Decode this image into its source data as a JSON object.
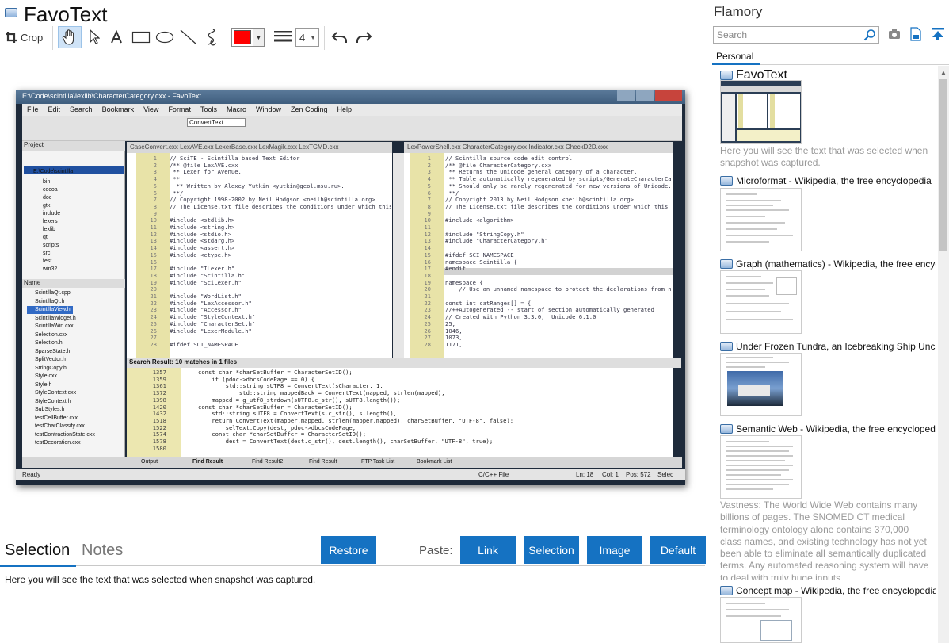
{
  "app": {
    "title": "FavoText"
  },
  "toolbar": {
    "crop_label": "Crop",
    "color": "#ff0000",
    "line_width": "4"
  },
  "snapshot": {
    "window_title": "E:\\Code\\scintilla\\lexlib\\CharacterCategory.cxx - FavoText",
    "menu": [
      "File",
      "Edit",
      "Search",
      "Bookmark",
      "View",
      "Format",
      "Tools",
      "Macro",
      "Window",
      "Zen Coding",
      "Help"
    ],
    "combo_value": "ConvertText",
    "project_label": "Project",
    "project_root": "E:\\Code\\scintilla",
    "folders": [
      "bin",
      "cocoa",
      "doc",
      "gtk",
      "include",
      "lexers",
      "lexlib",
      "qt",
      "scripts",
      "src",
      "test",
      "win32"
    ],
    "name_header": "Name",
    "files": [
      "ScintillaQt.cpp",
      "ScintillaQt.h",
      "ScintillaView.h",
      "ScintillaWidget.h",
      "ScintillaWin.cxx",
      "Selection.cxx",
      "Selection.h",
      "SparseState.h",
      "SplitVector.h",
      "StringCopy.h",
      "Style.cxx",
      "Style.h",
      "StyleContext.cxx",
      "StyleContext.h",
      "SubStyles.h",
      "testCellBuffer.cxx",
      "testCharClassify.cxx",
      "testContractionState.cxx",
      "testDecoration.cxx"
    ],
    "left_tabs": "CaseConvert.cxx   LexAVE.cxx   LexerBase.cxx   LexMagik.cxx   LexTCMD.cxx",
    "right_tabs": "LexPowerShell.cxx   CharacterCategory.cxx   Indicator.cxx   CheckD2D.cxx",
    "left_lines": "1\n2\n3\n4\n5\n6\n7\n8\n9\n10\n11\n12\n13\n14\n15\n16\n17\n18\n19\n20\n21\n22\n23\n24\n25\n26\n27\n28",
    "left_code": "// SciTE - Scintilla based Text Editor\n/** @file LexAVE.cxx\n ** Lexer for Avenue.\n **\n  ** Written by Alexey Yutkin <yutkin@geol.msu.ru>.\n **/\n// Copyright 1998-2002 by Neil Hodgson <neilh@scintilla.org>\n// The License.txt file describes the conditions under which this\n\n#include <stdlib.h>\n#include <string.h>\n#include <stdio.h>\n#include <stdarg.h>\n#include <assert.h>\n#include <ctype.h>\n\n#include \"ILexer.h\"\n#include \"Scintilla.h\"\n#include \"SciLexer.h\"\n\n#include \"WordList.h\"\n#include \"LexAccessor.h\"\n#include \"Accessor.h\"\n#include \"StyleContext.h\"\n#include \"CharacterSet.h\"\n#include \"LexerModule.h\"\n\n#ifdef SCI_NAMESPACE",
    "right_lines": "1\n2\n3\n4\n5\n6\n7\n8\n9\n10\n11\n12\n13\n14\n15\n16\n17\n18\n19\n20\n21\n22\n23\n24\n25\n26\n27\n28",
    "right_code": "// Scintilla source code edit control\n/** @file CharacterCategory.cxx\n ** Returns the Unicode general category of a character.\n ** Table automatically regenerated by scripts/GenerateCharacterCa\n ** Should only be rarely regenerated for new versions of Unicode.\n **/\n// Copyright 2013 by Neil Hodgson <neilh@scintilla.org>\n// The License.txt file describes the conditions under which this\n\n#include <algorithm>\n\n#include \"StringCopy.h\"\n#include \"CharacterCategory.h\"\n\n#ifdef SCI_NAMESPACE\nnamespace Scintilla {\n#endif\n\nnamespace {\n    // Use an unnamed namespace to protect the declarations from n\n\nconst int catRanges[] = {\n//++Autogenerated -- start of section automatically generated\n// Created with Python 3.3.0,  Unicode 6.1.0\n25,\n1046,\n1073,\n1171,",
    "results_header": "Search Result: 10 matches in 1 files",
    "results_lines": "1357\n1359\n1361\n1372\n1398\n1420\n1432\n1518\n1522\n1574\n1578\n1580",
    "results_code": "const char *charSetBuffer = CharacterSetID();\n    if (pdoc->dbcsCodePage == 0) {\n        std::string sUTF8 = ConvertText(sCharacter, 1,\n            std::string mappedBack = ConvertText(mapped, strlen(mapped),\n    mapped = g_utf8_strdown(sUTF8.c_str(), sUTF8.length());\nconst char *charSetBuffer = CharacterSetID();\n    std::string sUTF8 = ConvertText(s.c_str(), s.length(),\n    return ConvertText(mapper.mapped, strlen(mapper.mapped), charSetBuffer, \"UTF-8\", false);\n        selText.Copy(dest, pdoc->dbcsCodePage,\n    const char *charSetBuffer = CharacterSetID();\n        dest = ConvertText(dest.c_str(), dest.length(), charSetBuffer, \"UTF-8\", true);",
    "bottom_tabs": [
      "Output",
      "Find Result",
      "Find Result2",
      "Find Result",
      "FTP Task List",
      "Bookmark List"
    ],
    "status_ready": "Ready",
    "status_lang": "C/C++ File",
    "status_ln": "Ln: 18",
    "status_col": "Col: 1",
    "status_pos": "Pos: 572",
    "status_sel": "Selec"
  },
  "bottom": {
    "tabs": [
      "Selection",
      "Notes"
    ],
    "restore_label": "Restore",
    "paste_label": "Paste:",
    "paste_buttons": [
      "Link",
      "Selection",
      "Image",
      "Default"
    ],
    "selection_text": "Here you will see the text that was selected when snapshot was captured."
  },
  "sidebar": {
    "title": "Flamory",
    "search_placeholder": "Search",
    "tab": "Personal",
    "items": [
      {
        "title": "FavoText",
        "desc": "Here you will see the text that was selected when snapshot was captured."
      },
      {
        "title": "Microformat - Wikipedia, the free encyclopedia"
      },
      {
        "title": "Graph (mathematics) - Wikipedia, the free encyclopedia"
      },
      {
        "title": "Under Frozen Tundra, an Icebreaking Ship Uncovers"
      },
      {
        "title": "Semantic Web - Wikipedia, the free encyclopedia",
        "desc": "Vastness: The World Wide Web contains many billions of pages. The SNOMED CT medical terminology ontology alone contains 370,000 class names, and existing technology has not yet been able to eliminate all semantically duplicated terms. Any automated reasoning system will have to deal with truly huge inputs."
      },
      {
        "title": "Concept map - Wikipedia, the free encyclopedia"
      }
    ]
  },
  "colors": {
    "accent": "#1572c2",
    "pen": "#ff0000"
  },
  "icons": [
    "crop-icon",
    "hand-icon",
    "pointer-icon",
    "text-icon",
    "rectangle-icon",
    "ellipse-icon",
    "line-icon",
    "freehand-icon",
    "line-width-icon",
    "undo-icon",
    "redo-icon",
    "search-icon",
    "camera-icon",
    "page-icon",
    "pin-icon"
  ]
}
